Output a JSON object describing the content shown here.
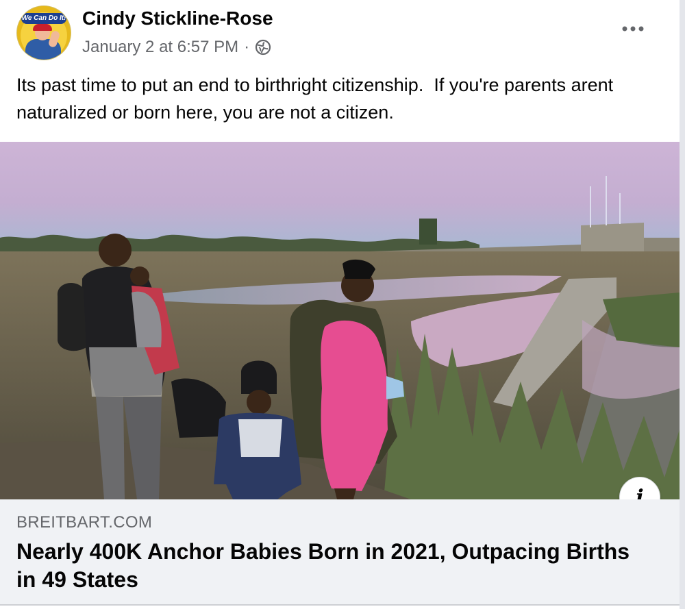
{
  "post": {
    "author": "Cindy Stickline-Rose",
    "avatar_text": "We Can Do It!",
    "timestamp": "January 2 at 6:57 PM",
    "separator": "·",
    "privacy_icon": "globe-icon",
    "more_icon": "more-options-icon",
    "text": "Its past time to put an end to birthright citizenship.  If you're parents arent naturalized or born here, you are not a citizen."
  },
  "link_preview": {
    "domain": "BREITBART.COM",
    "headline": "Nearly 400K Anchor Babies Born in 2021, Outpacing Births in 49 States",
    "info_label": "i"
  },
  "colors": {
    "text_primary": "#050505",
    "text_secondary": "#65676b",
    "link_background": "#f0f2f5"
  }
}
